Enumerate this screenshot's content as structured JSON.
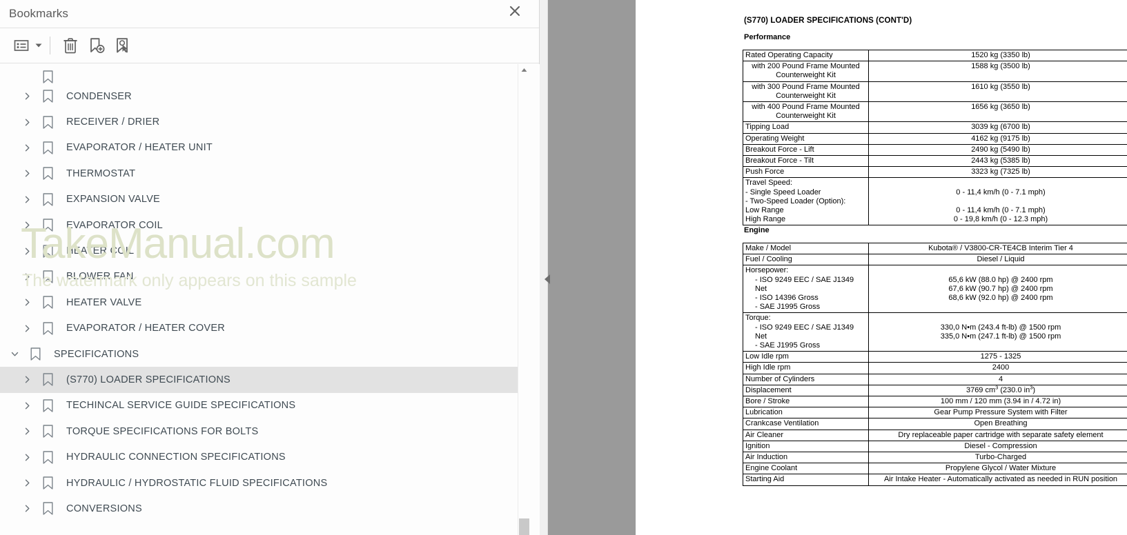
{
  "bookmarks_panel": {
    "title": "Bookmarks",
    "close_label": "×",
    "toolbar": {
      "options_label": "list-options",
      "caret_label": "dropdown",
      "delete_label": "Delete",
      "new_label": "New Bookmark",
      "select_label": "Select Bookmark"
    },
    "items": [
      {
        "label": "",
        "level": 1,
        "state": "collapsed",
        "selected": false,
        "partial": true
      },
      {
        "label": "CONDENSER",
        "level": 1,
        "state": "collapsed",
        "selected": false
      },
      {
        "label": "RECEIVER / DRIER",
        "level": 1,
        "state": "collapsed",
        "selected": false
      },
      {
        "label": "EVAPORATOR / HEATER UNIT",
        "level": 1,
        "state": "collapsed",
        "selected": false
      },
      {
        "label": "THERMOSTAT",
        "level": 1,
        "state": "collapsed",
        "selected": false
      },
      {
        "label": "EXPANSION VALVE",
        "level": 1,
        "state": "collapsed",
        "selected": false
      },
      {
        "label": "EVAPORATOR COIL",
        "level": 1,
        "state": "collapsed",
        "selected": false
      },
      {
        "label": "HEATER COIL",
        "level": 1,
        "state": "collapsed",
        "selected": false
      },
      {
        "label": "BLOWER FAN",
        "level": 1,
        "state": "collapsed",
        "selected": false
      },
      {
        "label": "HEATER VALVE",
        "level": 1,
        "state": "collapsed",
        "selected": false
      },
      {
        "label": "EVAPORATOR / HEATER COVER",
        "level": 1,
        "state": "collapsed",
        "selected": false
      },
      {
        "label": "SPECIFICATIONS",
        "level": 0,
        "state": "expanded",
        "selected": false
      },
      {
        "label": "(S770) LOADER SPECIFICATIONS",
        "level": 1,
        "state": "collapsed",
        "selected": true
      },
      {
        "label": "TECHINCAL SERVICE GUIDE SPECIFICATIONS",
        "level": 1,
        "state": "collapsed",
        "selected": false
      },
      {
        "label": "TORQUE SPECIFICATIONS FOR BOLTS",
        "level": 1,
        "state": "collapsed",
        "selected": false
      },
      {
        "label": "HYDRAULIC CONNECTION SPECIFICATIONS",
        "level": 1,
        "state": "collapsed",
        "selected": false
      },
      {
        "label": "HYDRAULIC / HYDROSTATIC FLUID SPECIFICATIONS",
        "level": 1,
        "state": "collapsed",
        "selected": false
      },
      {
        "label": "CONVERSIONS",
        "level": 1,
        "state": "collapsed",
        "selected": false
      }
    ]
  },
  "watermark": {
    "main": "TakeManual.com",
    "sub": "The watermark only appears on this sample",
    "color": "#dde2c8"
  },
  "document": {
    "title": "(S770) LOADER SPECIFICATIONS (CONT'D)",
    "performance_heading": "Performance",
    "engine_heading": "Engine",
    "performance_rows": [
      {
        "key": [
          "Rated Operating Capacity"
        ],
        "value": [
          "1520 kg (3350 lb)"
        ]
      },
      {
        "key": [
          "with 200 Pound Frame Mounted",
          "Counterweight Kit"
        ],
        "key_style": "indent-center",
        "value": [
          "1588 kg (3500 lb)"
        ]
      },
      {
        "key": [
          "with 300 Pound Frame Mounted",
          "Counterweight Kit"
        ],
        "key_style": "indent-center",
        "value": [
          "1610 kg (3550 lb)"
        ]
      },
      {
        "key": [
          "with 400 Pound Frame Mounted",
          "Counterweight Kit"
        ],
        "key_style": "indent-center",
        "value": [
          "1656 kg (3650 lb)"
        ]
      },
      {
        "key": [
          "Tipping Load"
        ],
        "value": [
          "3039 kg (6700 lb)"
        ]
      },
      {
        "key": [
          "Operating Weight"
        ],
        "value": [
          "4162 kg (9175 lb)"
        ]
      },
      {
        "key": [
          "Breakout Force - Lift"
        ],
        "value": [
          "2490 kg (5490 lb)"
        ]
      },
      {
        "key": [
          "Breakout Force - Tilt"
        ],
        "value": [
          "2443 kg (5385 lb)"
        ]
      },
      {
        "key": [
          "Push Force"
        ],
        "value": [
          "3323 kg (7325 lb)"
        ]
      },
      {
        "key": [
          "Travel Speed:",
          "- Single Speed Loader",
          "- Two-Speed Loader (Option):",
          "Low Range",
          "High Range"
        ],
        "value": [
          "",
          "0 - 11,4 km/h (0 - 7.1 mph)",
          "",
          "0 - 11,4 km/h (0 - 7.1 mph)",
          "0 - 19,8 km/h (0 - 12.3 mph)"
        ]
      }
    ],
    "engine_rows": [
      {
        "key": [
          "Make / Model"
        ],
        "value": [
          "Kubota® / V3800-CR-TE4CB Interim Tier 4"
        ]
      },
      {
        "key": [
          "Fuel / Cooling"
        ],
        "value": [
          "Diesel / Liquid"
        ]
      },
      {
        "key": [
          "Horsepower:",
          "  - ISO 9249 EEC / SAE J1349 Net",
          "  - ISO 14396 Gross",
          "  - SAE J1995 Gross"
        ],
        "value": [
          "",
          "65,6 kW (88.0 hp) @ 2400 rpm",
          "67,6 kW (90.7 hp) @ 2400 rpm",
          "68,6 kW (92.0 hp) @ 2400 rpm"
        ]
      },
      {
        "key": [
          "Torque:",
          "  - ISO 9249 EEC / SAE J1349 Net",
          "  - SAE J1995 Gross"
        ],
        "value": [
          "",
          "330,0 N•m (243.4 ft-lb) @ 1500 rpm",
          "335,0 N•m (247.1 ft-lb) @ 1500 rpm"
        ]
      },
      {
        "key": [
          "Low Idle rpm"
        ],
        "value": [
          "1275 - 1325"
        ]
      },
      {
        "key": [
          "High Idle rpm"
        ],
        "value": [
          "2400"
        ]
      },
      {
        "key": [
          "Number of Cylinders"
        ],
        "value": [
          "4"
        ]
      },
      {
        "key": [
          "Displacement"
        ],
        "value": [
          "3769 cm3 (230.0 in3)"
        ],
        "value_html": "3769 cm<sup>3</sup> (230.0 in<sup>3</sup>)"
      },
      {
        "key": [
          "Bore / Stroke"
        ],
        "value": [
          "100 mm / 120 mm (3.94 in / 4.72 in)"
        ]
      },
      {
        "key": [
          "Lubrication"
        ],
        "value": [
          "Gear Pump Pressure System with Filter"
        ]
      },
      {
        "key": [
          "Crankcase Ventilation"
        ],
        "value": [
          "Open Breathing"
        ]
      },
      {
        "key": [
          "Air Cleaner"
        ],
        "value": [
          "Dry replaceable paper cartridge with separate safety element"
        ]
      },
      {
        "key": [
          "Ignition"
        ],
        "value": [
          "Diesel - Compression"
        ]
      },
      {
        "key": [
          "Air Induction"
        ],
        "value": [
          "Turbo-Charged"
        ]
      },
      {
        "key": [
          "Engine Coolant"
        ],
        "value": [
          "Propylene Glycol / Water Mixture"
        ]
      },
      {
        "key": [
          "Starting Aid"
        ],
        "value": [
          "Air Intake Heater - Automatically activated as needed in RUN position"
        ]
      }
    ]
  }
}
